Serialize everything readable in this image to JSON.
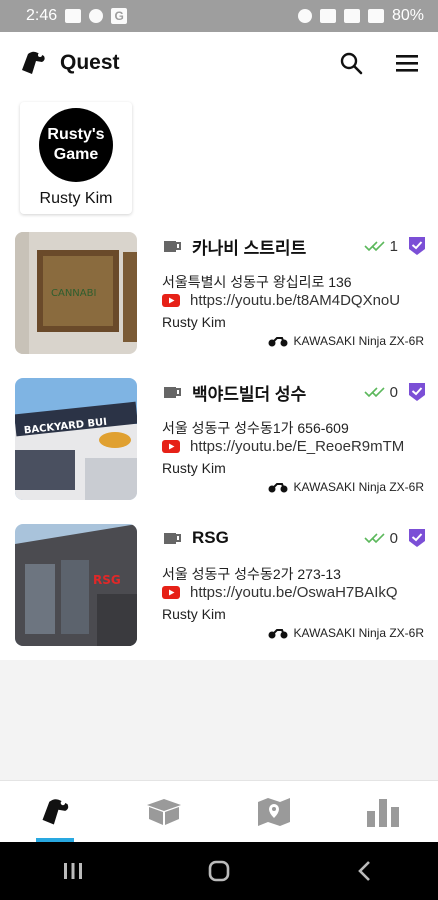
{
  "status_bar": {
    "time": "2:46",
    "battery": "80%"
  },
  "app_bar": {
    "title": "Quest",
    "icons": [
      "quest-logo-icon",
      "search-icon",
      "menu-icon"
    ]
  },
  "profiles": [
    {
      "avatar_text_line1": "Rusty's",
      "avatar_text_line2": "Game",
      "name": "Rusty Kim"
    }
  ],
  "cards": [
    {
      "title": "카나비 스트리트",
      "check_count": "1",
      "address": "서울특별시 성동구 왕십리로 136",
      "link": "https://youtu.be/t8AM4DQXnoU",
      "author": "Rusty Kim",
      "bike": "KAWASAKI Ninja ZX-6R"
    },
    {
      "title": "백야드빌더 성수",
      "check_count": "0",
      "address": "서울 성동구 성수동1가 656-609",
      "link": "https://youtu.be/E_ReoeR9mTM",
      "author": "Rusty Kim",
      "bike": "KAWASAKI Ninja ZX-6R"
    },
    {
      "title": "RSG",
      "check_count": "0",
      "address": "서울 성동구 성수동2가 273-13",
      "link": "https://youtu.be/OswaH7BAIkQ",
      "author": "Rusty Kim",
      "bike": "KAWASAKI Ninja ZX-6R"
    }
  ],
  "bottom_nav": [
    "quest-tab-icon",
    "box-tab-icon",
    "map-tab-icon",
    "stats-tab-icon"
  ],
  "colors": {
    "accent": "#29a8e0",
    "badge": "#7b4fd6",
    "check": "#5cb85c",
    "youtube": "#e62117"
  }
}
